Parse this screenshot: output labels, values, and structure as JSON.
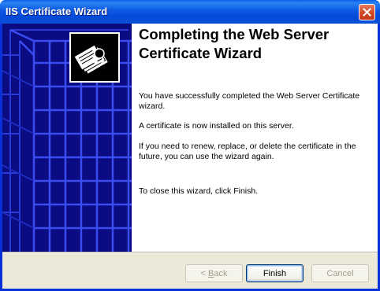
{
  "window": {
    "title": "IIS Certificate Wizard",
    "close_icon": "close-icon"
  },
  "side_panel": {
    "icon": "certificate-icon"
  },
  "content": {
    "heading_line1": "Completing the Web Server",
    "heading_line2": "Certificate Wizard",
    "para1": "You have successfully completed the Web Server Certificate wizard.",
    "para2": "A certificate is now installed on this server.",
    "para3": "If you need to renew, replace, or delete the certificate in the future, you can use the wizard again.",
    "para4": "To close this wizard, click Finish."
  },
  "buttons": {
    "back_prefix": "< ",
    "back_mnemonic": "B",
    "back_rest": "ack",
    "finish": "Finish",
    "cancel": "Cancel"
  },
  "colors": {
    "titlebar": "#0c58e3",
    "side_panel": "#0a0a7a",
    "client_bg": "#ece9d8"
  }
}
